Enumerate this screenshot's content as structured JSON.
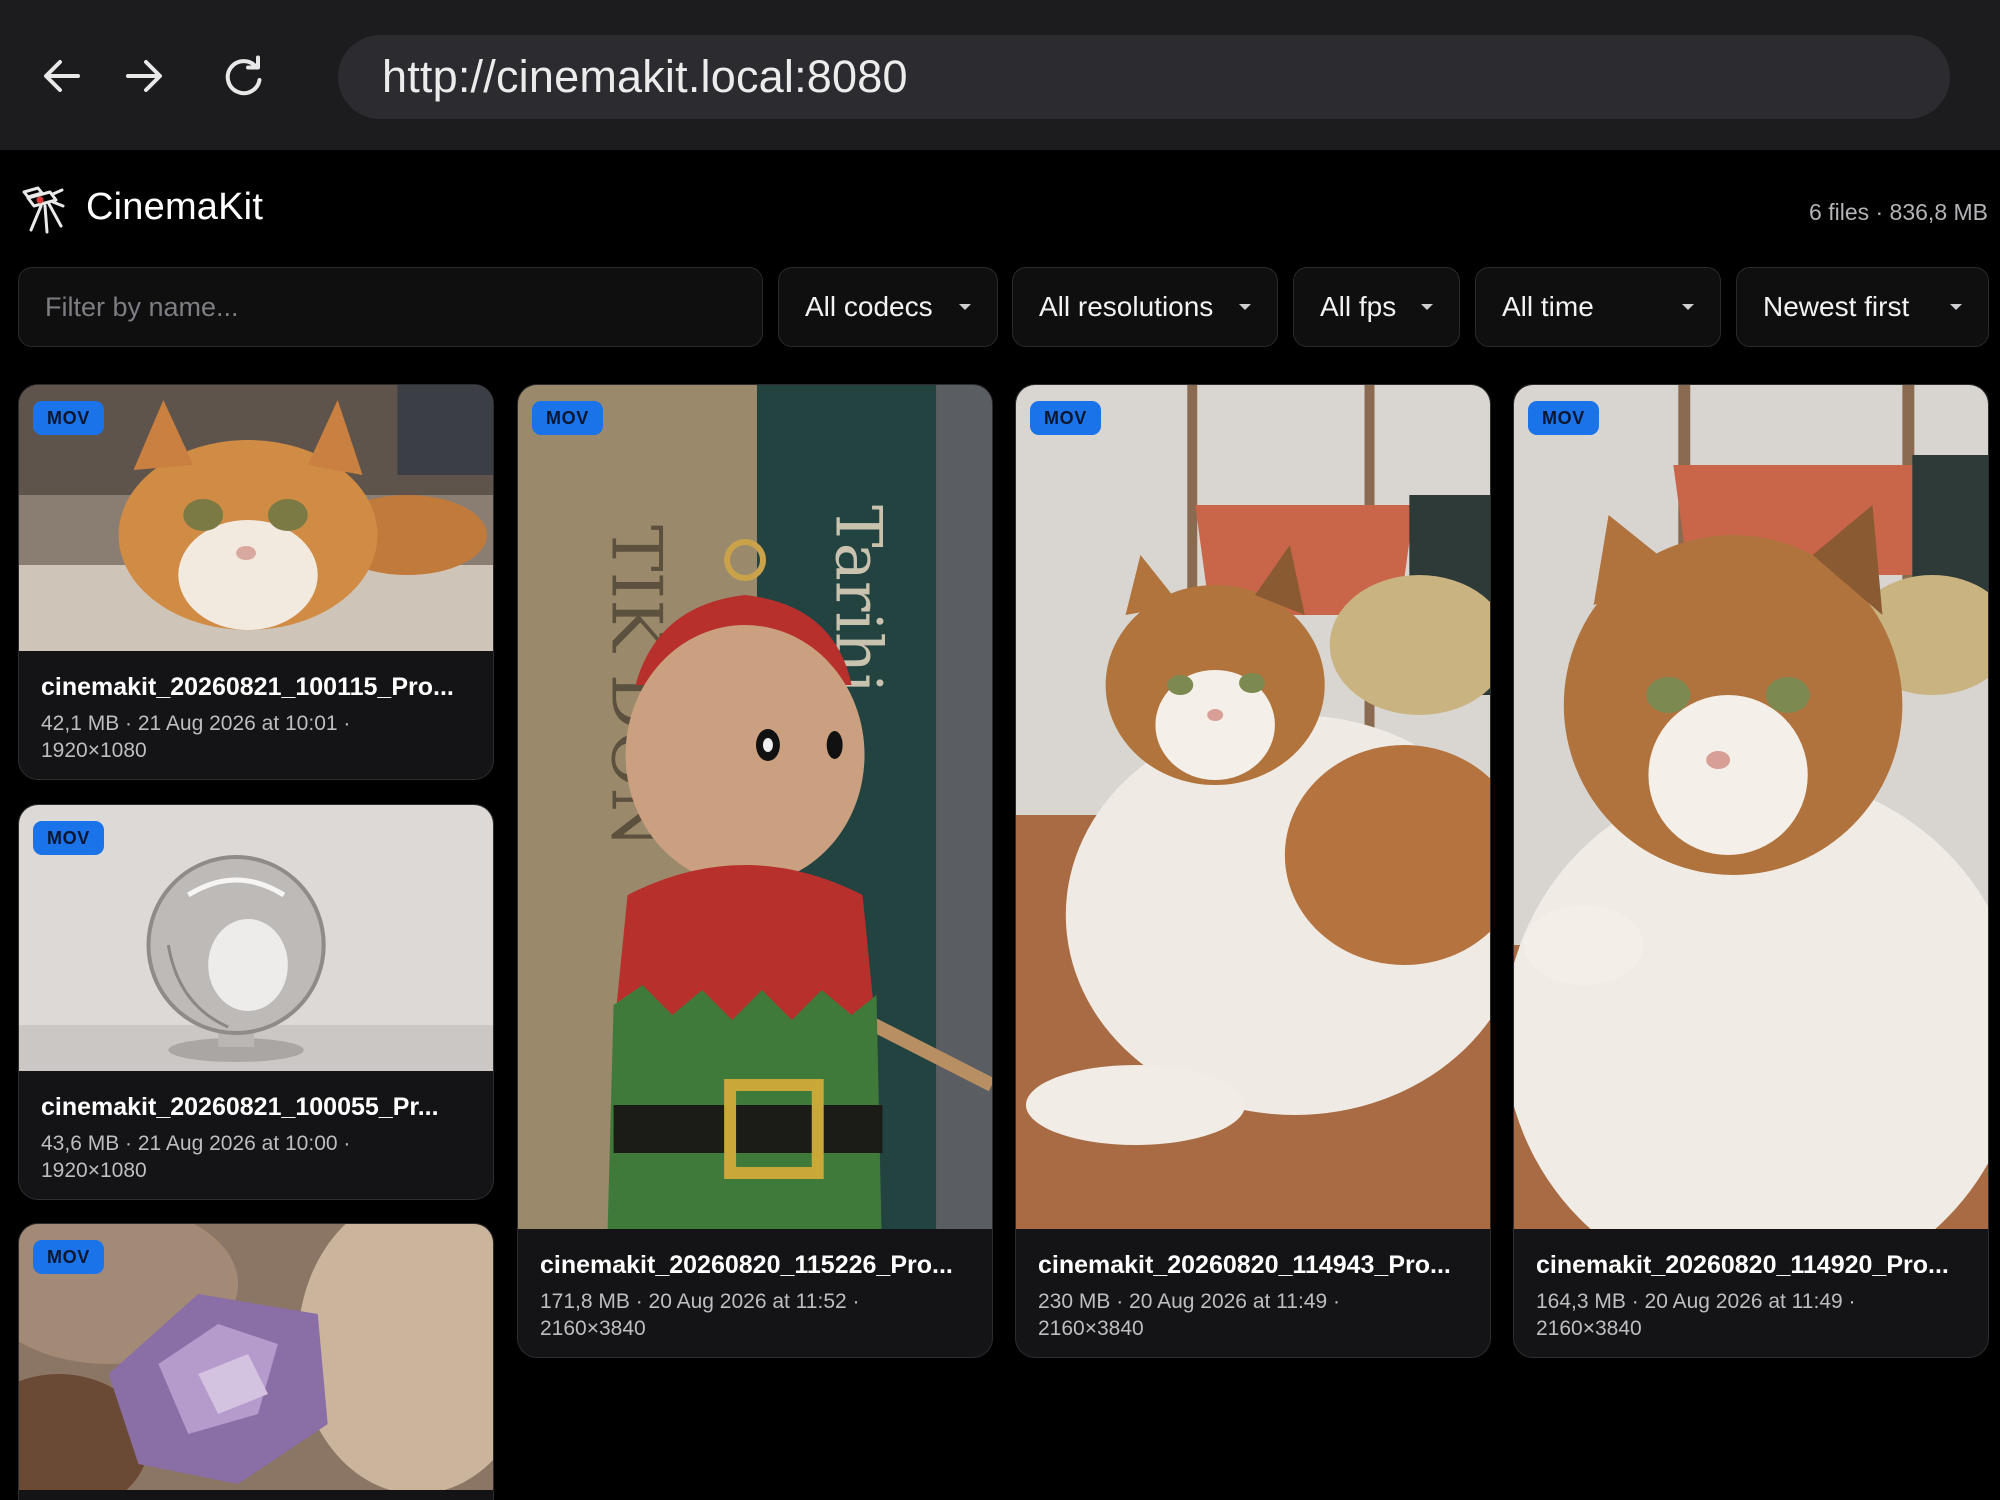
{
  "browser": {
    "url": "http://cinemakit.local:8080",
    "back_icon": "arrow-left-icon",
    "forward_icon": "arrow-right-icon",
    "reload_icon": "reload-icon"
  },
  "app": {
    "name": "CinemaKit",
    "logo_icon": "camera-tripod-icon",
    "summary": "6 files · 836,8 MB"
  },
  "filters": {
    "search_placeholder": "Filter by name...",
    "codec": "All codecs",
    "resolution": "All resolutions",
    "fps": "All fps",
    "time": "All time",
    "sort": "Newest first"
  },
  "files": [
    {
      "badge": "MOV",
      "name": "cinemakit_20260821_100115_Pro...",
      "meta": "42,1 MB · 21 Aug 2026 at 10:01 ·",
      "resolution": "1920×1080",
      "thumb": "orange-cat"
    },
    {
      "badge": "MOV",
      "name": "cinemakit_20260821_100055_Pr...",
      "meta": "43,6 MB · 21 Aug 2026 at 10:00 ·",
      "resolution": "1920×1080",
      "thumb": "glass-sphere"
    },
    {
      "badge": "MOV",
      "name": "",
      "meta": "",
      "resolution": "",
      "thumb": "amethyst-crystal"
    },
    {
      "badge": "MOV",
      "name": "cinemakit_20260820_115226_Pro...",
      "meta": "171,8 MB · 20 Aug 2026 at 11:52 ·",
      "resolution": "2160×3840",
      "thumb": "wooden-elf-figure"
    },
    {
      "badge": "MOV",
      "name": "cinemakit_20260820_114943_Pro...",
      "meta": "230 MB · 20 Aug 2026 at 11:49 ·",
      "resolution": "2160×3840",
      "thumb": "calico-cat-lying"
    },
    {
      "badge": "MOV",
      "name": "cinemakit_20260820_114920_Pro...",
      "meta": "164,3 MB · 20 Aug 2026 at 11:49 ·",
      "resolution": "2160×3840",
      "thumb": "calico-cat-closeup"
    }
  ]
}
